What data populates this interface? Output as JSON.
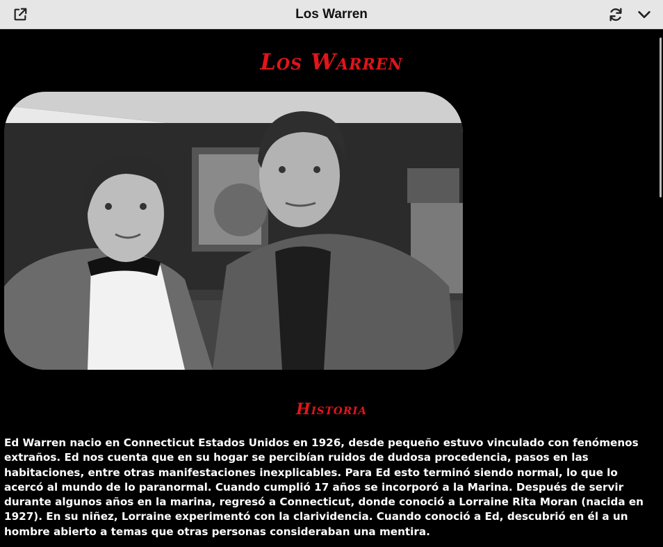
{
  "window": {
    "title": "Los Warren",
    "open_external_icon": "open-external-icon",
    "refresh_icon": "refresh-icon",
    "collapse_icon": "chevron-down-icon"
  },
  "page": {
    "title": "Los Warren",
    "photo_alt": "Ed y Lorraine Warren",
    "section_title": "Historia",
    "story": "Ed Warren nacio en Connecticut Estados Unidos en 1926, desde pequeño estuvo vinculado con fenómenos extraños. Ed nos cuenta que en su hogar se percibían ruidos de dudosa procedencia, pasos en las habitaciones, entre otras manifestaciones inexplicables. Para Ed esto terminó siendo normal, lo que lo acercó al mundo de lo paranormal. Cuando cumplió 17 años se incorporó a la Marina. Después de servir durante algunos años en la marina, regresó a Connecticut, donde conoció a Lorraine Rita Moran (nacida en 1927). En su niñez, Lorraine experimentó con la clarividencia. Cuando conoció a Ed, descubrió en él a un hombre abierto a temas que otras personas consideraban una mentira."
  },
  "colors": {
    "heading": "#e0151b",
    "background": "#000000",
    "text": "#ffffff",
    "toolbar": "#e6e6e6"
  }
}
